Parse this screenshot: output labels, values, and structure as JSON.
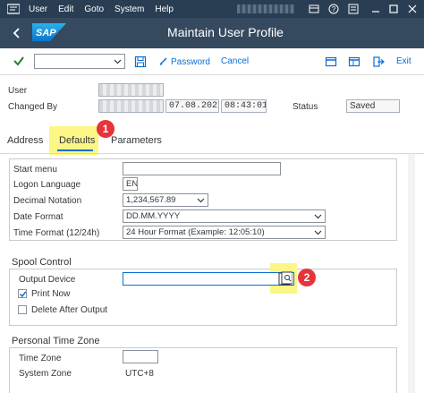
{
  "menubar": {
    "items": [
      "User",
      "Edit",
      "Goto",
      "System",
      "Help"
    ]
  },
  "titlebar": {
    "title": "Maintain User Profile",
    "logo_text": "SAP"
  },
  "toolbar": {
    "command_field_value": "",
    "password_label": "Password",
    "cancel_label": "Cancel",
    "exit_label": "Exit"
  },
  "header": {
    "user_label": "User",
    "changed_by_label": "Changed By",
    "changed_date": "07.08.2021",
    "changed_time": "08:43:01",
    "status_label": "Status",
    "status_value": "Saved"
  },
  "tabs": [
    {
      "label": "Address"
    },
    {
      "label": "Defaults"
    },
    {
      "label": "Parameters"
    }
  ],
  "defaults": {
    "start_menu_label": "Start menu",
    "start_menu_value": "",
    "logon_language_label": "Logon Language",
    "logon_language_value": "EN",
    "decimal_notation_label": "Decimal Notation",
    "decimal_notation_value": "1,234,567.89",
    "date_format_label": "Date Format",
    "date_format_value": "DD.MM.YYYY",
    "time_format_label": "Time Format (12/24h)",
    "time_format_value": "24 Hour Format (Example: 12:05:10)"
  },
  "spool": {
    "title": "Spool Control",
    "output_device_label": "Output Device",
    "output_device_value": "",
    "print_now_label": "Print Now",
    "print_now_checked": true,
    "delete_after_output_label": "Delete After Output",
    "delete_after_output_checked": false
  },
  "timezone": {
    "title": "Personal Time Zone",
    "time_zone_label": "Time Zone",
    "time_zone_value": "",
    "system_zone_label": "System Zone",
    "system_zone_value": "UTC+8"
  },
  "annotations": {
    "badge_1": "1",
    "badge_2": "2",
    "badge_color": "#e8333a",
    "highlight_color": "#fbf686"
  },
  "colors": {
    "menubar_bg": "#2a3e53",
    "titlebar_bg": "#354a5f",
    "link_blue": "#0a6ed1"
  }
}
